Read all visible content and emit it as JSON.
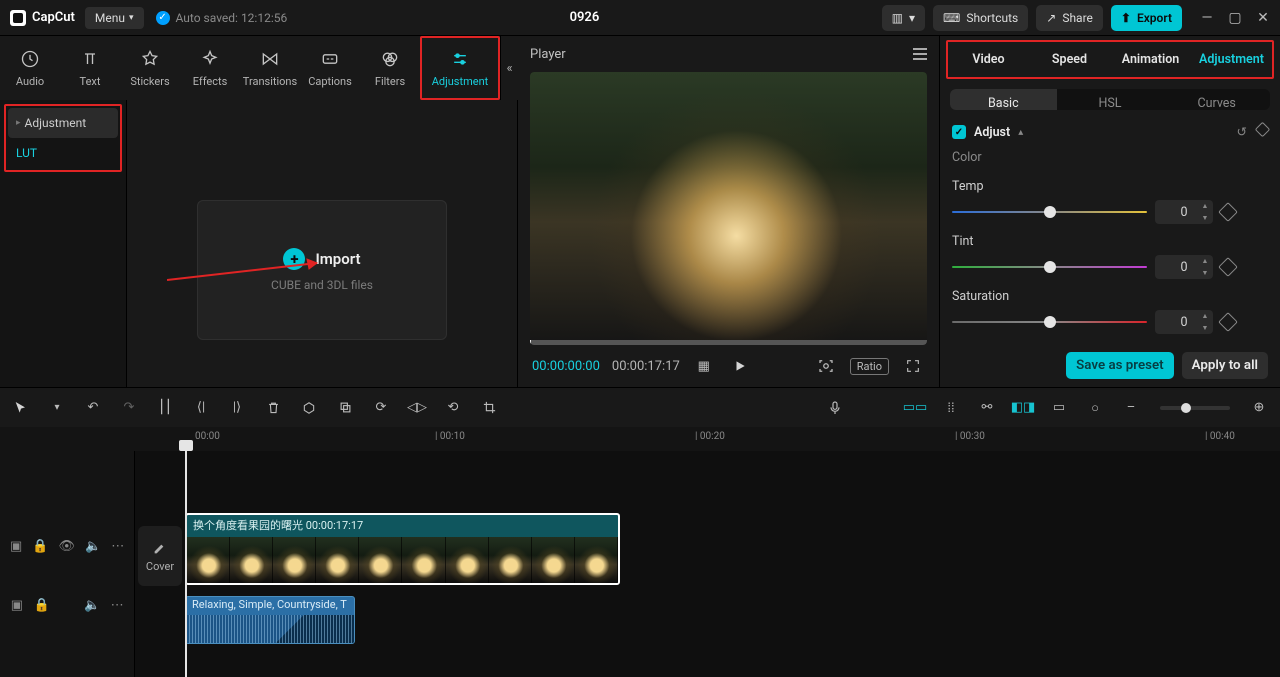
{
  "titlebar": {
    "app_name": "CapCut",
    "menu_label": "Menu",
    "autosave_label": "Auto saved: 12:12:56",
    "document_title": "0926",
    "shortcuts_label": "Shortcuts",
    "share_label": "Share",
    "export_label": "Export"
  },
  "toptabs": {
    "audio": "Audio",
    "text": "Text",
    "stickers": "Stickers",
    "effects": "Effects",
    "transitions": "Transitions",
    "captions": "Captions",
    "filters": "Filters",
    "adjustment": "Adjustment"
  },
  "left_sidebar": {
    "adjustment": "Adjustment",
    "lut": "LUT"
  },
  "asset_panel": {
    "import_label": "Import",
    "import_hint": "CUBE and 3DL files"
  },
  "player": {
    "title": "Player",
    "current_time": "00:00:00:00",
    "total_time": "00:00:17:17",
    "ratio_label": "Ratio"
  },
  "right_panel": {
    "tabs": {
      "video": "Video",
      "speed": "Speed",
      "animation": "Animation",
      "adjustment": "Adjustment"
    },
    "subtabs": {
      "basic": "Basic",
      "hsl": "HSL",
      "curves": "Curves"
    },
    "adjust_section": "Adjust",
    "color_group": "Color",
    "temp_label": "Temp",
    "tint_label": "Tint",
    "sat_label": "Saturation",
    "value_zero": "0",
    "save_preset": "Save as preset",
    "apply_all": "Apply to all"
  },
  "ruler": {
    "t0": "00:00",
    "t1": "| 00:10",
    "t2": "| 00:20",
    "t3": "| 00:30",
    "t4": "| 00:40"
  },
  "timeline": {
    "cover_label": "Cover",
    "video_clip_title": "换个角度看果园的曙光  00:00:17:17",
    "audio_clip_title": "Relaxing, Simple, Countryside, T"
  }
}
